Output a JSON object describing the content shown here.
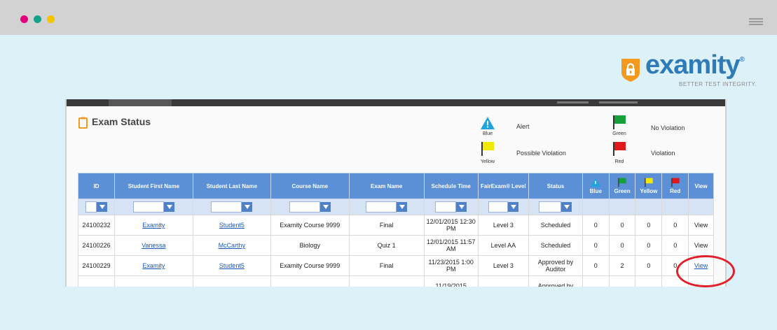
{
  "window": {
    "dots": [
      "#e6007e",
      "#12a38a",
      "#f5c400"
    ]
  },
  "brand": {
    "name": "examity",
    "tagline": "BETTER TEST INTEGRITY."
  },
  "panel": {
    "title": "Exam Status"
  },
  "legend": [
    {
      "flag": "Blue",
      "label": "Alert",
      "color": "#1fa4dc",
      "shape": "triangle-icon"
    },
    {
      "flag": "Green",
      "label": "No Violation",
      "color": "#16a03a",
      "shape": "flag-icon"
    },
    {
      "flag": "Yellow",
      "label": "Possible Violation",
      "color": "#f2e900",
      "shape": "flag-icon"
    },
    {
      "flag": "Red",
      "label": "Violation",
      "color": "#e01a1a",
      "shape": "flag-icon"
    }
  ],
  "table": {
    "headers": [
      "ID",
      "Student First Name",
      "Student Last Name",
      "Course Name",
      "Exam Name",
      "Schedule Time",
      "FairExam® Level",
      "Status",
      "Blue",
      "Green",
      "Yellow",
      "Red",
      "View"
    ],
    "rows": [
      {
        "id": "24100232",
        "first": "Examity",
        "last": "Student5",
        "course": "Examity Course 9999",
        "exam": "Final",
        "time": "12/01/2015 12:30 PM",
        "level": "Level 3",
        "status": "Scheduled",
        "blue": "0",
        "green": "0",
        "yellow": "0",
        "red": "0",
        "view": "View"
      },
      {
        "id": "24100226",
        "first": "Vanessa",
        "last": "McCarthy",
        "course": "Biology",
        "exam": "Quiz 1",
        "time": "12/01/2015 11:57 AM",
        "level": "Level AA",
        "status": "Scheduled",
        "blue": "0",
        "green": "0",
        "yellow": "0",
        "red": "0",
        "view": "View"
      },
      {
        "id": "24100229",
        "first": "Examity",
        "last": "Student5",
        "course": "Examity Course 9999",
        "exam": "Final",
        "time": "11/23/2015 1:00 PM",
        "level": "Level 3",
        "status": "Approved by Auditor",
        "blue": "0",
        "green": "2",
        "yellow": "0",
        "red": "0",
        "view": "View"
      },
      {
        "id": "",
        "first": "",
        "last": "",
        "course": "",
        "exam": "",
        "time": "11/19/2015",
        "level": "",
        "status": "Approved by",
        "blue": "",
        "green": "",
        "yellow": "",
        "red": "",
        "view": ""
      }
    ]
  }
}
